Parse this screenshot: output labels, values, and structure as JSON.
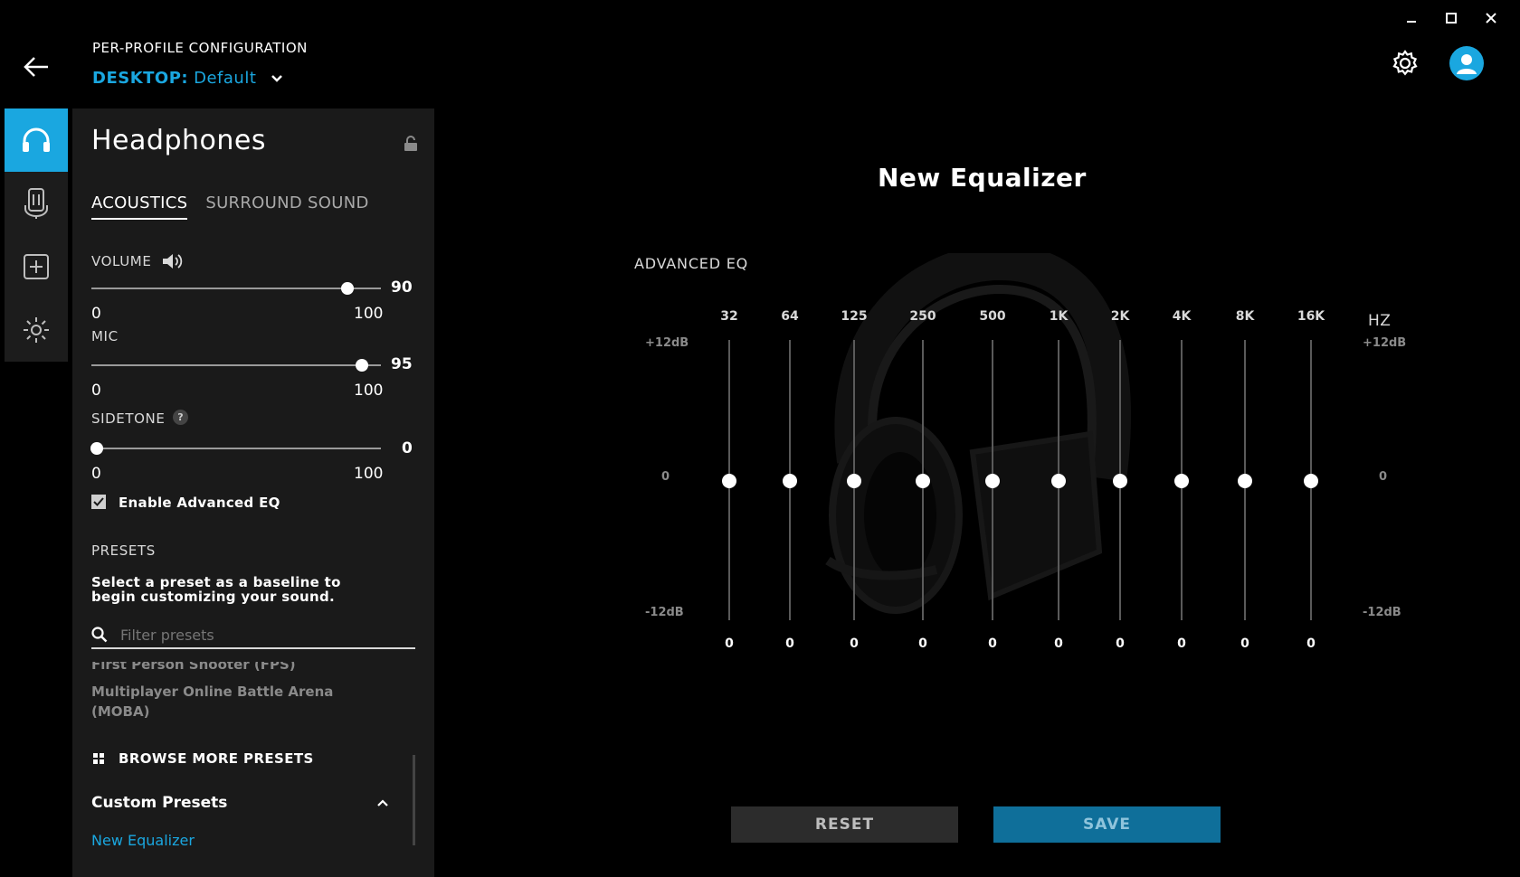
{
  "header": {
    "config_title": "PER-PROFILE CONFIGURATION",
    "profile_key": "DESKTOP:",
    "profile_value": "Default"
  },
  "sidebar_icons": [
    {
      "name": "headphones-icon",
      "active": true
    },
    {
      "name": "microphone-icon",
      "active": false
    },
    {
      "name": "add-icon",
      "active": false
    },
    {
      "name": "lighting-icon",
      "active": false
    }
  ],
  "panel": {
    "title": "Headphones",
    "tabs": [
      {
        "label": "ACOUSTICS",
        "active": true
      },
      {
        "label": "SURROUND SOUND",
        "active": false
      }
    ],
    "volume": {
      "label": "VOLUME",
      "value": "90",
      "min": "0",
      "max": "100",
      "level": 90
    },
    "mic": {
      "label": "MIC",
      "value": "95",
      "min": "0",
      "max": "100",
      "level": 95
    },
    "sidetone": {
      "label": "SIDETONE",
      "help": "?",
      "value": "0",
      "min": "0",
      "max": "100",
      "level": 0
    },
    "advanced_eq_label": "Enable Advanced EQ",
    "advanced_eq_checked": true,
    "presets_title": "PRESETS",
    "presets_desc": "Select a preset as a baseline to begin customizing your sound.",
    "search_placeholder": "Filter presets",
    "preset_items": [
      "First Person Shooter (FPS)",
      "Multiplayer Online Battle Arena (MOBA)"
    ],
    "browse_label": "BROWSE MORE PRESETS",
    "custom_title": "Custom Presets",
    "custom_items": [
      "New Equalizer"
    ]
  },
  "equalizer": {
    "title": "New Equalizer",
    "section_label": "ADVANCED EQ",
    "unit_label": "HZ",
    "db_top": "+12dB",
    "db_mid": "0",
    "db_bottom": "-12dB",
    "bands": [
      {
        "freq": "32",
        "value": "0"
      },
      {
        "freq": "64",
        "value": "0"
      },
      {
        "freq": "125",
        "value": "0"
      },
      {
        "freq": "250",
        "value": "0"
      },
      {
        "freq": "500",
        "value": "0"
      },
      {
        "freq": "1K",
        "value": "0"
      },
      {
        "freq": "2K",
        "value": "0"
      },
      {
        "freq": "4K",
        "value": "0"
      },
      {
        "freq": "8K",
        "value": "0"
      },
      {
        "freq": "16K",
        "value": "0"
      }
    ]
  },
  "actions": {
    "reset_label": "RESET",
    "save_label": "SAVE"
  },
  "colors": {
    "accent": "#1aa7e0",
    "save_bg": "#0f6f9a",
    "panel_bg": "#1a1a1a"
  }
}
